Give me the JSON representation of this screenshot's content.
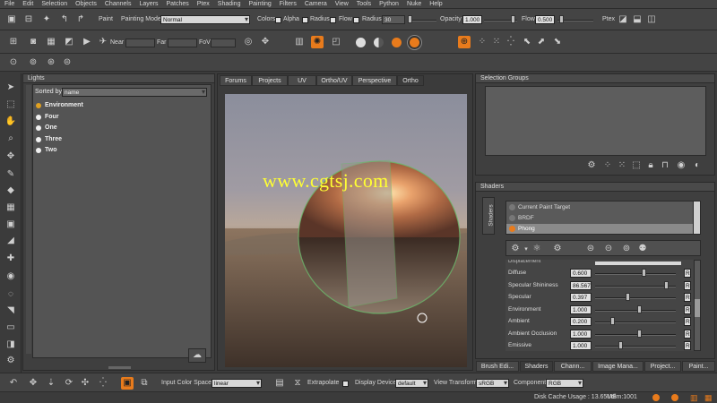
{
  "menu": [
    "File",
    "Edit",
    "Selection",
    "Objects",
    "Channels",
    "Layers",
    "Patches",
    "Ptex",
    "Shading",
    "Painting",
    "Filters",
    "Camera",
    "View",
    "Tools",
    "Python",
    "Nuke",
    "Help"
  ],
  "toolbar1": {
    "paint_label": "Paint",
    "painting_mode_label": "Painting Mode",
    "painting_mode_value": "Normal",
    "colors_label": "Colors",
    "alpha_label": "Alpha",
    "radius_label": "Radius",
    "flow_label": "Flow",
    "radius2_label": "Radius",
    "radius_value": "30",
    "opacity_label": "Opacity",
    "opacity_value": "1.000",
    "flow2_label": "Flow",
    "flow_value": "0.500",
    "ptex_label": "Ptex"
  },
  "toolbar2": {
    "near_label": "Near",
    "far_label": "Far",
    "fov_label": "FoV"
  },
  "lights_panel": {
    "title": "Lights",
    "sorted_by_label": "Sorted by",
    "sorted_by_value": "name",
    "items": [
      "Environment",
      "Four",
      "One",
      "Three",
      "Two"
    ]
  },
  "viewport": {
    "tabs": [
      "Forums",
      "Projects",
      "UV",
      "Ortho/UV",
      "Perspective",
      "Ortho"
    ],
    "active_tab": "Ortho",
    "watermark": "www.cgtsj.com"
  },
  "selection_groups": {
    "title": "Selection Groups"
  },
  "shaders": {
    "title": "Shaders",
    "side_tab": "Shaders",
    "list": [
      "Current Paint Target",
      "BRDF",
      "Phong"
    ],
    "selected": "Phong",
    "props_header": "Displacement",
    "props": [
      {
        "name": "Diffuse",
        "value": "0.600",
        "fill": 0.6
      },
      {
        "name": "Specular Shininess",
        "value": "86.567",
        "fill": 0.9
      },
      {
        "name": "Specular",
        "value": "0.397",
        "fill": 0.4
      },
      {
        "name": "Environment",
        "value": "1.000",
        "fill": 0.55
      },
      {
        "name": "Ambient",
        "value": "0.200",
        "fill": 0.2
      },
      {
        "name": "Ambient Occlusion",
        "value": "1.000",
        "fill": 0.55
      },
      {
        "name": "Emissive",
        "value": "1.000",
        "fill": 0.3
      }
    ],
    "r_label": "R"
  },
  "right_tabs": [
    "Brush Edi...",
    "Shaders",
    "Chann...",
    "Image Mana...",
    "Project...",
    "Paint..."
  ],
  "bottom": {
    "input_cs_label": "Input Color Space",
    "input_cs_value": "linear",
    "extrapolate_label": "Extrapolate",
    "display_device_label": "Display Device",
    "display_device_value": "default",
    "view_transform_label": "View Transform",
    "view_transform_value": "sRGB",
    "component_label": "Component",
    "component_value": "RGB"
  },
  "status": {
    "disk_cache": "Disk Cache Usage : 13.65MB",
    "udim": "Udim:1001"
  },
  "colors": {
    "accent": "#e87b1c",
    "bg": "#3b3b3b",
    "selected": "#8a8a8a"
  }
}
